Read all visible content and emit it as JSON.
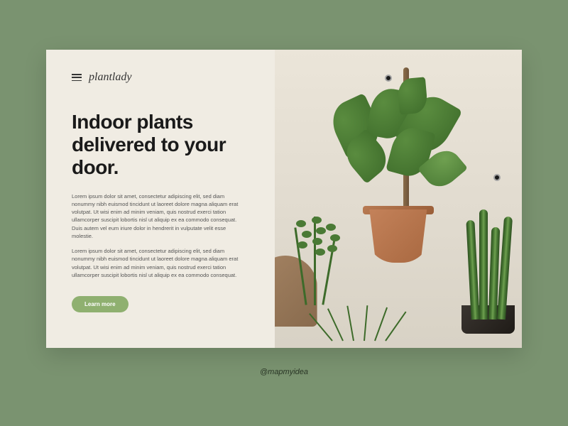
{
  "brand": {
    "name": "plantlady"
  },
  "hero": {
    "headline": "Indoor plants delivered to your door.",
    "paragraph1": "Lorem ipsum dolor sit amet, consectetur adipiscing elit, sed diam nonummy nibh euismod tincidunt ut laoreet dolore magna aliquam erat volutpat. Ut wisi enim ad minim veniam, quis nostrud exerci tation ullamcorper suscipit lobortis nisl ut aliquip ex ea commodo consequat. Duis autem vel eum iriure dolor in hendrerit in vulputate velit esse molestie.",
    "paragraph2": "Lorem ipsum dolor sit amet, consectetur adipiscing elit, sed diam nonummy nibh euismod tincidunt ut laoreet dolore magna aliquam erat volutpat. Ut wisi enim ad minim veniam, quis nostrud exerci tation ullamcorper suscipit lobortis nisl ut aliquip ex ea commodo consequat.",
    "cta_label": "Learn more"
  },
  "credit": "@mapmyidea",
  "colors": {
    "background": "#7a9370",
    "card": "#f0ece3",
    "accent": "#8fb070",
    "text_dark": "#1a1a1a"
  }
}
